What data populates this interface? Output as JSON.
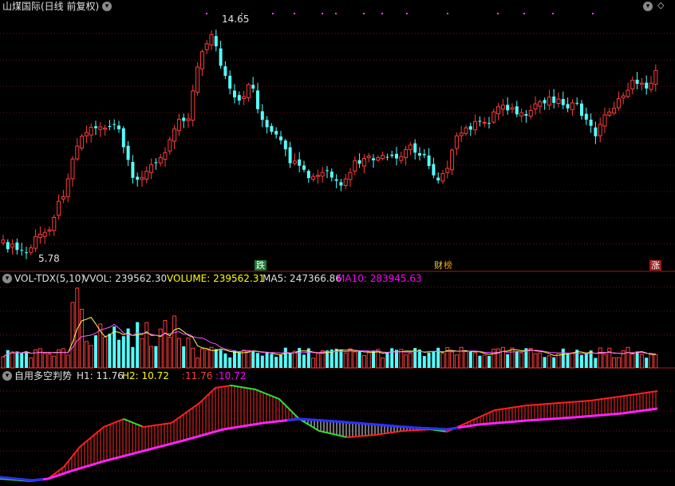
{
  "main": {
    "title": "山煤国际(日线 前复权)",
    "high_label": "14.65",
    "low_label": "5.78",
    "badges": [
      {
        "text": "跌",
        "color": "#22aa44"
      },
      {
        "text": "财",
        "color": "#ddcc44"
      },
      {
        "text": "榜",
        "color": "#ff8800"
      },
      {
        "text": "涨",
        "color": "#cc2222"
      }
    ]
  },
  "vol": {
    "name": "VOL-TDX(5,10)",
    "vvol": "VVOL: 239562.30",
    "volume": "VOLUME: 239562.31",
    "ma5": "MA5: 247366.86",
    "ma10": "MA10: 283945.63"
  },
  "ind": {
    "name": "自用多空判势",
    "h1": "H1: 11.76",
    "h2": "H2: 10.72",
    "v1": ":11.76",
    "v2": ":10.72"
  },
  "colors": {
    "up": "#ff3c3c",
    "down": "#54ffff",
    "vol_label": "#ffff00",
    "ma10": "#ff00ff"
  },
  "icons": [
    "chevron-down-icon",
    "circle-down-icon",
    "diamond-icon"
  ]
}
